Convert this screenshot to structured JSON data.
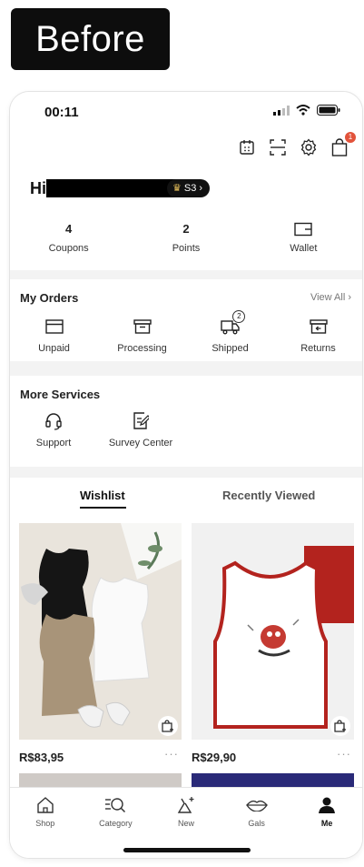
{
  "label": {
    "text": "Before"
  },
  "status_bar": {
    "time": "00:11"
  },
  "header": {
    "cart_badge": "1"
  },
  "profile": {
    "greeting": "Hi",
    "level": "S3",
    "level_chevron": "›"
  },
  "stats": [
    {
      "value": "4",
      "label": "Coupons"
    },
    {
      "value": "2",
      "label": "Points"
    },
    {
      "value": "",
      "label": "Wallet",
      "icon": "wallet-icon"
    }
  ],
  "orders": {
    "title": "My Orders",
    "view_all": "View All ›",
    "items": [
      {
        "label": "Unpaid",
        "icon": "unpaid-icon"
      },
      {
        "label": "Processing",
        "icon": "processing-icon"
      },
      {
        "label": "Shipped",
        "icon": "shipped-icon",
        "badge": "2"
      },
      {
        "label": "Returns",
        "icon": "returns-icon"
      }
    ]
  },
  "services": {
    "title": "More Services",
    "items": [
      {
        "label": "Support",
        "icon": "headset-icon"
      },
      {
        "label": "Survey Center",
        "icon": "survey-icon"
      }
    ]
  },
  "wishlist": {
    "tabs": [
      {
        "label": "Wishlist",
        "active": true
      },
      {
        "label": "Recently Viewed",
        "active": false
      }
    ],
    "products": [
      {
        "price": "R$83,95",
        "more": "···"
      },
      {
        "price": "R$29,90",
        "more": "···"
      }
    ]
  },
  "bottom_nav": [
    {
      "label": "Shop",
      "icon": "home-icon"
    },
    {
      "label": "Category",
      "icon": "category-search-icon"
    },
    {
      "label": "New",
      "icon": "new-icon"
    },
    {
      "label": "Gals",
      "icon": "lips-icon"
    },
    {
      "label": "Me",
      "icon": "person-icon",
      "active": true
    }
  ],
  "colors": {
    "accent_badge": "#e2533b",
    "level_badge_bg": "#111111",
    "crown": "#e8c15c"
  }
}
